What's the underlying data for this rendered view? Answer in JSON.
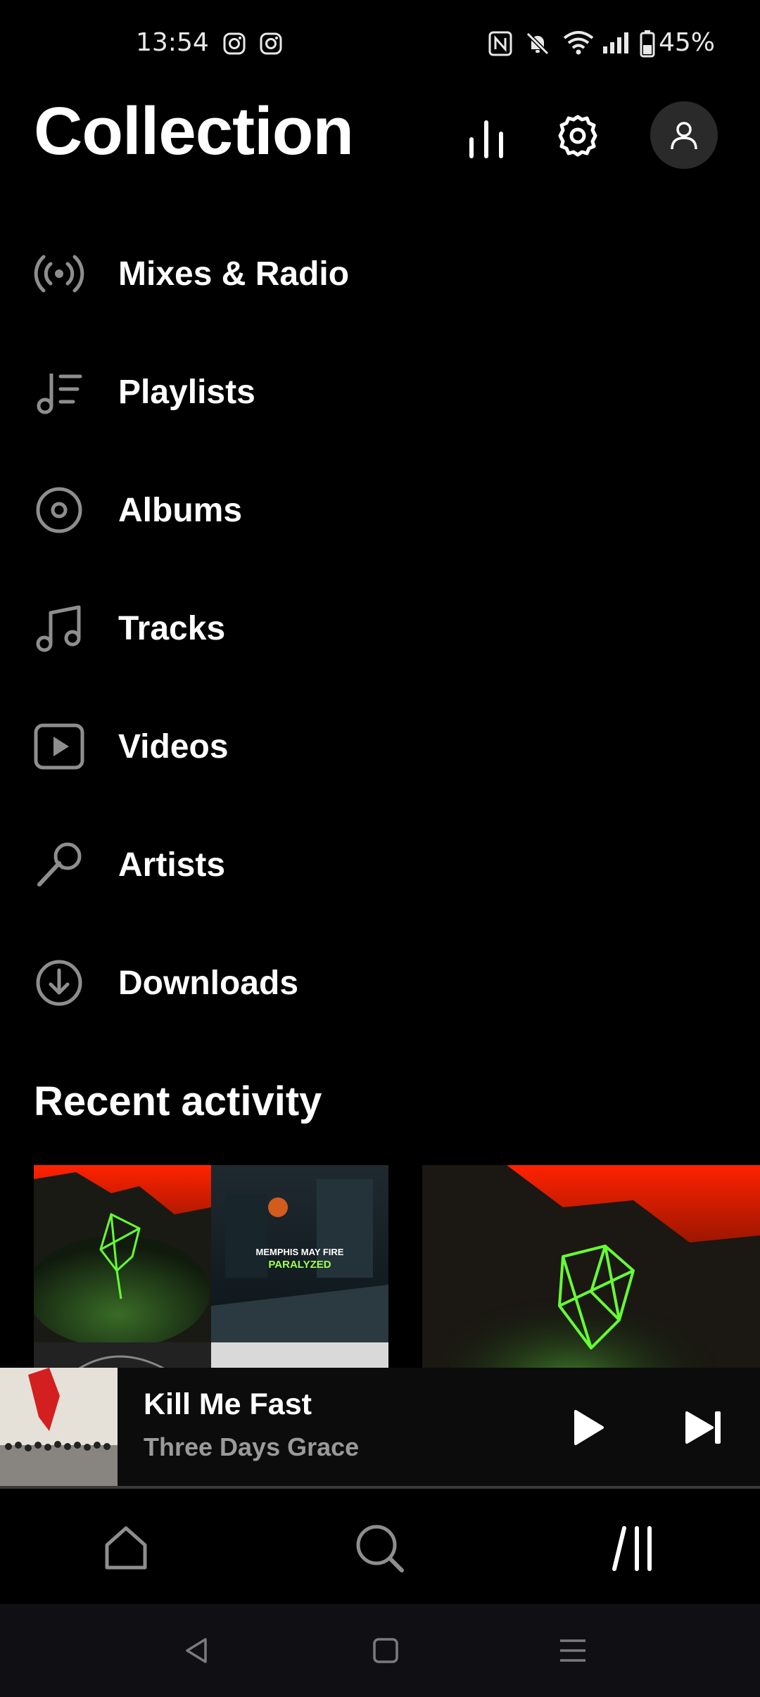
{
  "status_bar": {
    "time": "13:54",
    "battery": "45%",
    "icons": [
      "instagram-icon",
      "instagram-icon",
      "nfc-icon",
      "mute-icon",
      "wifi-icon",
      "signal-icon",
      "battery-icon"
    ]
  },
  "header": {
    "title": "Collection",
    "actions": [
      "stats-icon",
      "settings-icon",
      "profile-icon"
    ]
  },
  "menu": {
    "items": [
      {
        "label": "Mixes & Radio",
        "icon": "radio-icon"
      },
      {
        "label": "Playlists",
        "icon": "playlist-icon"
      },
      {
        "label": "Albums",
        "icon": "album-icon"
      },
      {
        "label": "Tracks",
        "icon": "music-note-icon"
      },
      {
        "label": "Videos",
        "icon": "video-icon"
      },
      {
        "label": "Artists",
        "icon": "microphone-icon"
      },
      {
        "label": "Downloads",
        "icon": "download-icon"
      }
    ]
  },
  "recent_activity": {
    "title": "Recent activity",
    "cards": [
      {
        "art_text_line1": "MEMPHIS MAY FIRE",
        "art_text_line2": "PARALYZED"
      }
    ]
  },
  "mini_player": {
    "title": "Kill Me Fast",
    "artist": "Three Days Grace",
    "progress": 0.0
  },
  "bottom_nav": {
    "items": [
      "home-icon",
      "search-icon",
      "collection-icon"
    ]
  },
  "colors": {
    "background": "#000000",
    "text": "#ffffff",
    "icon_gray": "#8e8e8e",
    "secondary_text": "#9a9a9a",
    "profile_bg": "#2a2a2a"
  }
}
